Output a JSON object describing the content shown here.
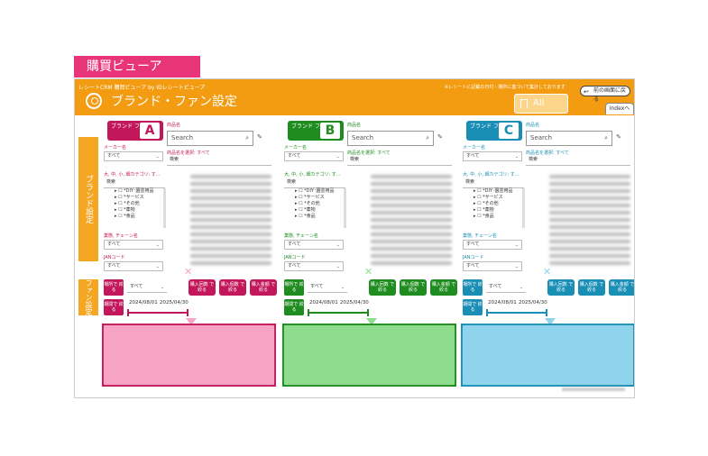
{
  "page_tag": "購買ビューア",
  "header": {
    "app_name": "レシートCRM 購買ビューア by IDレシートビューア",
    "note": "※レシートに記載の日付・場所に基づいて集計しております",
    "title": "ブランド・ファン設定",
    "all_clear": "All Clear",
    "back_button": "前の画面に戻る",
    "index_tab": "Indexへ"
  },
  "side_labels": {
    "brand": "ブランド設定",
    "fan": "ファン設定"
  },
  "panels": [
    {
      "id": "A",
      "color": "#c2185b",
      "light": "#f7a3c4",
      "brand_label": "ブランド ファン",
      "letter": "A"
    },
    {
      "id": "B",
      "color": "#1e8c1e",
      "light": "#8fdc8f",
      "brand_label": "ブランド ファン",
      "letter": "B"
    },
    {
      "id": "C",
      "color": "#1a8fb5",
      "light": "#8fd3ec",
      "brand_label": "ブランド ファン",
      "letter": "C"
    }
  ],
  "panel_labels": {
    "maker": "メーカー名",
    "maker_value": "すべて",
    "category": "大, 中, 小, 細カテゴリ: す...",
    "category_search": "検索",
    "category_items": [
      "*DIY･園芸用品",
      "*サービス",
      "*その他",
      "*薬物",
      "*食品"
    ],
    "chain": "業態, チェーン名",
    "chain_value": "すべて",
    "jan": "JANコード",
    "jan_value": "すべて",
    "product": "商品名",
    "search_placeholder": "Search",
    "product_select": "商品名を選択: すべて",
    "product_search": "検索"
  },
  "fan_controls": {
    "place_btn": "場所で 絞る",
    "place_value": "すべて",
    "period_btn": "期間で 絞る",
    "date_from": "2024/08/01",
    "date_to": "2025/04/30",
    "buy_times": "購入回数 で絞る",
    "buy_count": "購入個数 で絞る",
    "buy_amount": "購入金額 で絞る"
  },
  "icons": {
    "search": "search-icon",
    "eraser": "eraser-icon",
    "bookmark": "bookmark-icon",
    "back": "back-arrow-icon"
  }
}
